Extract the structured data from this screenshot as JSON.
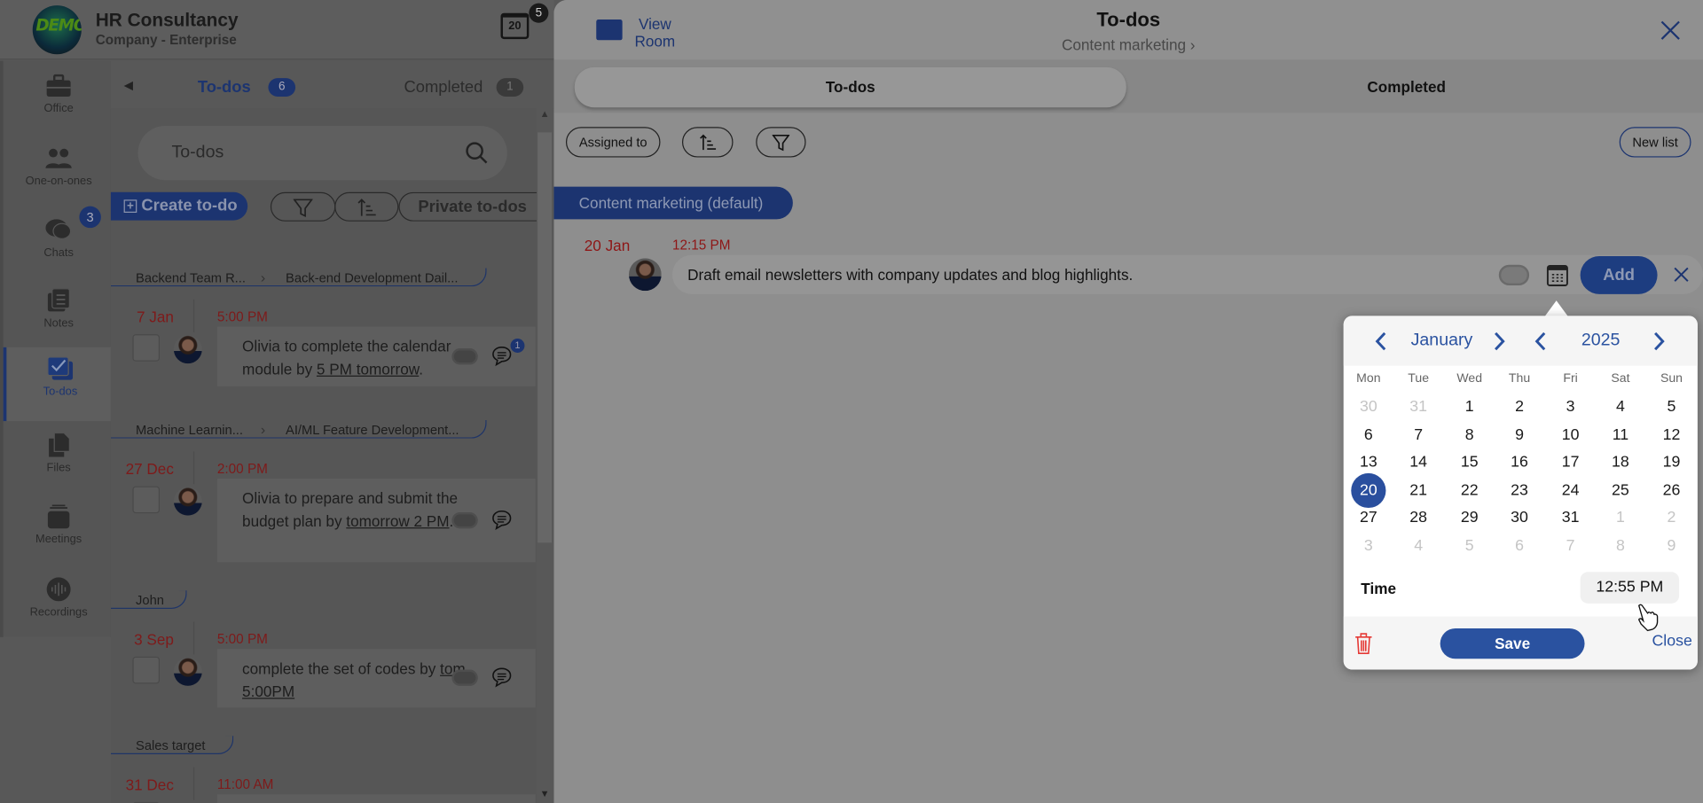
{
  "app": {
    "company": "HR Consultancy",
    "plan": "Company - Enterprise",
    "logo_text": "DEMO",
    "calendar_day": "20",
    "notification_count": "5"
  },
  "sidebar": {
    "items": [
      {
        "label": "Office",
        "icon": "briefcase-icon"
      },
      {
        "label": "One-on-ones",
        "icon": "people-icon"
      },
      {
        "label": "Chats",
        "icon": "chat-bubbles-icon",
        "badge": "3"
      },
      {
        "label": "Notes",
        "icon": "notes-icon"
      },
      {
        "label": "To-dos",
        "icon": "checkbox-icon",
        "active": true
      },
      {
        "label": "Files",
        "icon": "files-icon"
      },
      {
        "label": "Meetings",
        "icon": "meetings-icon"
      },
      {
        "label": "Recordings",
        "icon": "waveform-icon"
      }
    ]
  },
  "list": {
    "tabs": [
      {
        "label": "To-dos",
        "count": "6"
      },
      {
        "label": "Completed",
        "count": "1"
      }
    ],
    "search_placeholder": "To-dos",
    "create_label": "Create to-do",
    "private_label": "Private to-dos",
    "groups": [
      {
        "crumbs": [
          "Backend Team R...",
          "Back-end Development Dail..."
        ],
        "date": "7 Jan",
        "time": "5:00 PM",
        "text": "Olivia to complete the calendar module by ",
        "link": "5 PM tomorrow",
        "tail": ".",
        "comment_badge": "1"
      },
      {
        "crumbs": [
          "Machine Learnin...",
          "AI/ML Feature Development..."
        ],
        "date": "27 Dec",
        "time": "2:00 PM",
        "text": "Olivia to prepare and submit the budget plan by ",
        "link": "tomorrow 2 PM",
        "tail": "."
      },
      {
        "crumbs": [
          "John"
        ],
        "date": "3 Sep",
        "time": "5:00 PM",
        "text": "complete the set of codes by ",
        "link": "tom 5:00PM",
        "tail": ""
      },
      {
        "crumbs": [
          "Sales target"
        ],
        "date": "31 Dec",
        "time": "11:00 AM",
        "text": "",
        "link": "",
        "tail": ""
      }
    ]
  },
  "panel": {
    "view_room": "View Room",
    "title": "To-dos",
    "subtitle": "Content marketing ›",
    "tabs": [
      "To-dos",
      "Completed"
    ],
    "assigned_label": "Assigned to",
    "new_list_label": "New list",
    "list_chip": "Content marketing (default)",
    "entry": {
      "date": "20 Jan",
      "time": "12:15 PM",
      "text": "Draft email newsletters with company updates and blog highlights.",
      "add_label": "Add"
    }
  },
  "datepicker": {
    "month": "January",
    "year": "2025",
    "weekdays": [
      "Mon",
      "Tue",
      "Wed",
      "Thu",
      "Fri",
      "Sat",
      "Sun"
    ],
    "weeks": [
      [
        [
          "30",
          1
        ],
        [
          "31",
          1
        ],
        [
          "1",
          0
        ],
        [
          "2",
          0
        ],
        [
          "3",
          0
        ],
        [
          "4",
          0
        ],
        [
          "5",
          0
        ]
      ],
      [
        [
          "6",
          0
        ],
        [
          "7",
          0
        ],
        [
          "8",
          0
        ],
        [
          "9",
          0
        ],
        [
          "10",
          0
        ],
        [
          "11",
          0
        ],
        [
          "12",
          0
        ]
      ],
      [
        [
          "13",
          0
        ],
        [
          "14",
          0
        ],
        [
          "15",
          0
        ],
        [
          "16",
          0
        ],
        [
          "17",
          0
        ],
        [
          "18",
          0
        ],
        [
          "19",
          0
        ]
      ],
      [
        [
          "20",
          2
        ],
        [
          "21",
          0
        ],
        [
          "22",
          0
        ],
        [
          "23",
          0
        ],
        [
          "24",
          0
        ],
        [
          "25",
          0
        ],
        [
          "26",
          0
        ]
      ],
      [
        [
          "27",
          0
        ],
        [
          "28",
          0
        ],
        [
          "29",
          0
        ],
        [
          "30",
          0
        ],
        [
          "31",
          0
        ],
        [
          "1",
          1
        ],
        [
          "2",
          1
        ]
      ],
      [
        [
          "3",
          1
        ],
        [
          "4",
          1
        ],
        [
          "5",
          1
        ],
        [
          "6",
          1
        ],
        [
          "7",
          1
        ],
        [
          "8",
          1
        ],
        [
          "9",
          1
        ]
      ]
    ],
    "selected": "20",
    "time_label": "Time",
    "time_value": "12:55 PM",
    "save_label": "Save",
    "close_label": "Close",
    "colors": {
      "accent": "#2a52a0",
      "selected": "#2a4f9e",
      "delete": "#e53935"
    }
  }
}
